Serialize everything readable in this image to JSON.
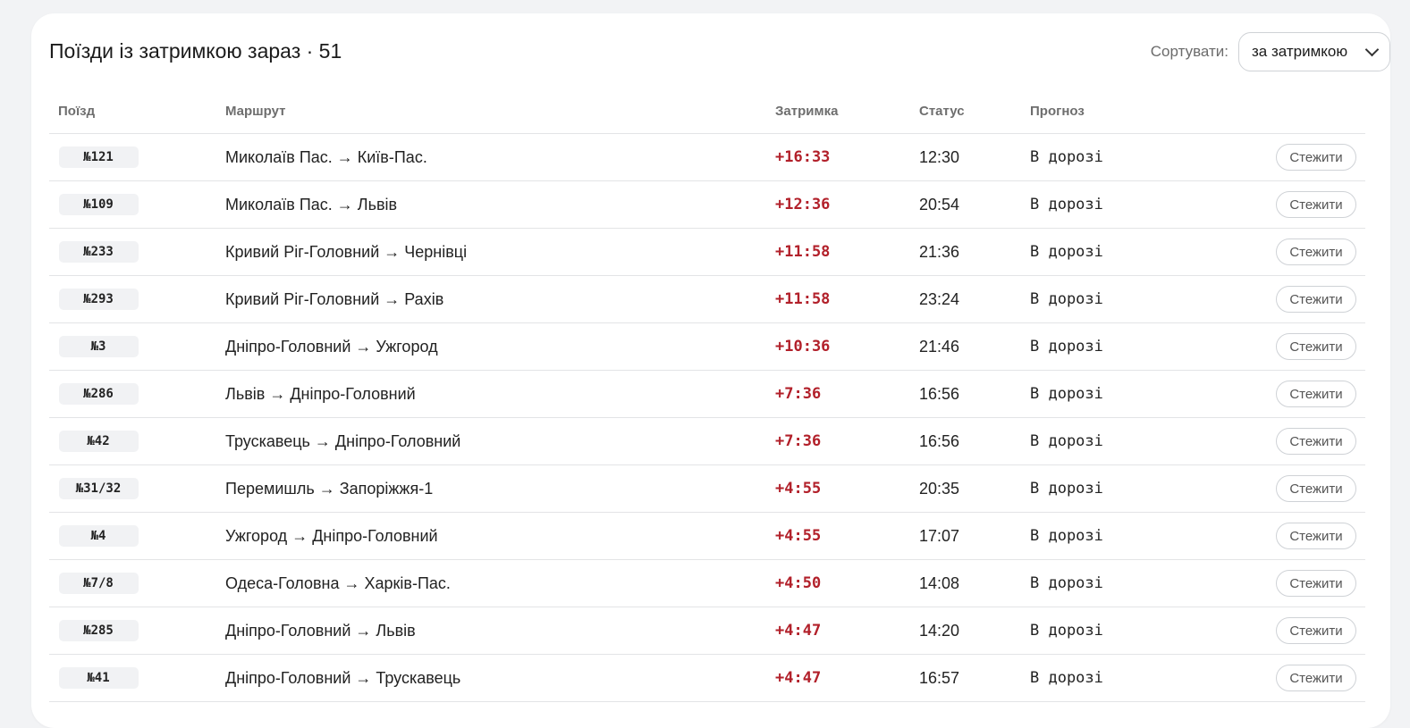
{
  "header": {
    "title": "Поїзди із затримкою зараз · 51",
    "sort_label": "Сортувати:",
    "sort_value": "за затримкою"
  },
  "columns": {
    "train": "Поїзд",
    "route": "Маршрут",
    "delay": "Затримка",
    "status": "Статус",
    "forecast": "Прогноз"
  },
  "rows": [
    {
      "train": "№121",
      "route": "Миколаїв Пас. → Київ-Пас.",
      "delay": "+16:33",
      "status": "12:30",
      "forecast": "В дорозі",
      "action": "Стежити"
    },
    {
      "train": "№109",
      "route": "Миколаїв Пас. → Львів",
      "delay": "+12:36",
      "status": "20:54",
      "forecast": "В дорозі",
      "action": "Стежити"
    },
    {
      "train": "№233",
      "route": "Кривий Ріг-Головний → Чернівці",
      "delay": "+11:58",
      "status": "21:36",
      "forecast": "В дорозі",
      "action": "Стежити"
    },
    {
      "train": "№293",
      "route": "Кривий Ріг-Головний → Рахів",
      "delay": "+11:58",
      "status": "23:24",
      "forecast": "В дорозі",
      "action": "Стежити"
    },
    {
      "train": "№3",
      "route": "Дніпро-Головний → Ужгород",
      "delay": "+10:36",
      "status": "21:46",
      "forecast": "В дорозі",
      "action": "Стежити"
    },
    {
      "train": "№286",
      "route": "Львів → Дніпро-Головний",
      "delay": "+7:36",
      "status": "16:56",
      "forecast": "В дорозі",
      "action": "Стежити"
    },
    {
      "train": "№42",
      "route": "Трускавець → Дніпро-Головний",
      "delay": "+7:36",
      "status": "16:56",
      "forecast": "В дорозі",
      "action": "Стежити"
    },
    {
      "train": "№31/32",
      "route": "Перемишль → Запоріжжя-1",
      "delay": "+4:55",
      "status": "20:35",
      "forecast": "В дорозі",
      "action": "Стежити"
    },
    {
      "train": "№4",
      "route": "Ужгород → Дніпро-Головний",
      "delay": "+4:55",
      "status": "17:07",
      "forecast": "В дорозі",
      "action": "Стежити"
    },
    {
      "train": "№7/8",
      "route": "Одеса-Головна → Харків-Пас.",
      "delay": "+4:50",
      "status": "14:08",
      "forecast": "В дорозі",
      "action": "Стежити"
    },
    {
      "train": "№285",
      "route": "Дніпро-Головний → Львів",
      "delay": "+4:47",
      "status": "14:20",
      "forecast": "В дорозі",
      "action": "Стежити"
    },
    {
      "train": "№41",
      "route": "Дніпро-Головний → Трускавець",
      "delay": "+4:47",
      "status": "16:57",
      "forecast": "В дорозі",
      "action": "Стежити"
    }
  ],
  "colors": {
    "delay": "#b2202a",
    "background": "#f2f3f5",
    "card": "#ffffff"
  },
  "icons": {
    "sort_select": "chevron-down-icon"
  }
}
